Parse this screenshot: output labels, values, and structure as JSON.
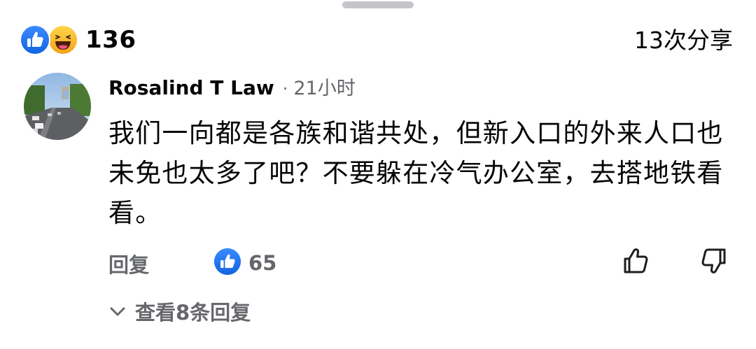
{
  "reactions": {
    "count": "136",
    "icons": [
      "like-icon",
      "haha-icon"
    ],
    "like_color": "#1877f2",
    "haha_color": "#f7b125"
  },
  "share": {
    "label": "13次分享"
  },
  "comment": {
    "author": "Rosalind T Law",
    "separator": "·",
    "time": "21小时",
    "text": "我们一向都是各族和谐共处，但新入口的外来人口也未免也太多了吧？不要躲在冷气办公室，去搭地铁看看。",
    "reply_label": "回复",
    "like_count": "65",
    "like_icon": "thumbs-up-outline-icon",
    "dislike_icon": "thumbs-down-outline-icon"
  },
  "replies": {
    "label": "查看8条回复",
    "icon": "chevron-down-icon"
  },
  "colors": {
    "text_primary": "#050505",
    "text_secondary": "#65676b",
    "accent": "#1877f2"
  }
}
